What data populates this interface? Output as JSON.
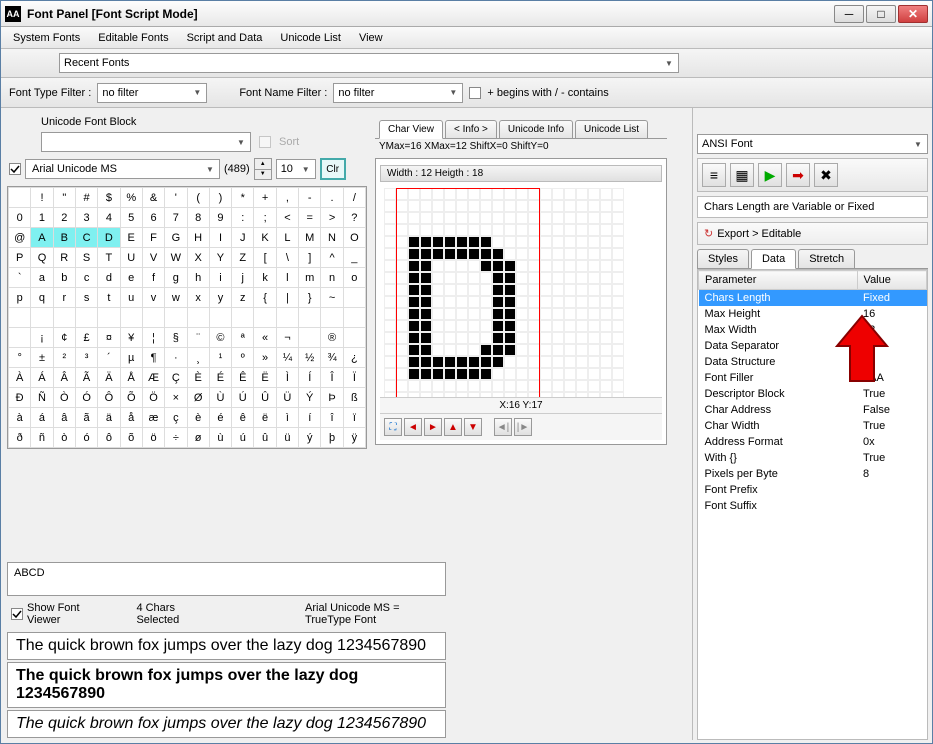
{
  "title": "Font Panel [Font Script Mode]",
  "menu": [
    "System Fonts",
    "Editable Fonts",
    "Script and Data",
    "Unicode List",
    "View"
  ],
  "recent_label": "Recent Fonts",
  "filter": {
    "type_label": "Font Type Filter :",
    "type_value": "no filter",
    "name_label": "Font Name Filter :",
    "name_value": "no filter",
    "begins_label": "+ begins with / - contains"
  },
  "block": {
    "label": "Unicode Font Block",
    "sort": "Sort"
  },
  "font": {
    "name": "Arial Unicode MS",
    "count": "(489)",
    "size": "10",
    "clr": "Clr"
  },
  "char_rows": [
    [
      "",
      "!",
      "\"",
      "#",
      "$",
      "%",
      "&",
      "'",
      "(",
      ")",
      "*",
      "+",
      ",",
      "-",
      ".",
      "/"
    ],
    [
      "0",
      "1",
      "2",
      "3",
      "4",
      "5",
      "6",
      "7",
      "8",
      "9",
      ":",
      ";",
      "<",
      "=",
      ">",
      "?"
    ],
    [
      "@",
      "A",
      "B",
      "C",
      "D",
      "E",
      "F",
      "G",
      "H",
      "I",
      "J",
      "K",
      "L",
      "M",
      "N",
      "O"
    ],
    [
      "P",
      "Q",
      "R",
      "S",
      "T",
      "U",
      "V",
      "W",
      "X",
      "Y",
      "Z",
      "[",
      "\\",
      "]",
      "^",
      "_"
    ],
    [
      "`",
      "a",
      "b",
      "c",
      "d",
      "e",
      "f",
      "g",
      "h",
      "i",
      "j",
      "k",
      "l",
      "m",
      "n",
      "o"
    ],
    [
      "p",
      "q",
      "r",
      "s",
      "t",
      "u",
      "v",
      "w",
      "x",
      "y",
      "z",
      "{",
      "|",
      "}",
      "~",
      ""
    ],
    [
      "",
      "",
      "",
      "",
      "",
      "",
      "",
      "",
      "",
      "",
      "",
      "",
      "",
      "",
      "",
      ""
    ],
    [
      "",
      "¡",
      "¢",
      "£",
      "¤",
      "¥",
      "¦",
      "§",
      "¨",
      "©",
      "ª",
      "«",
      "¬",
      "­",
      "®",
      ""
    ],
    [
      "°",
      "±",
      "²",
      "³",
      "´",
      "µ",
      "¶",
      "·",
      "¸",
      "¹",
      "º",
      "»",
      "¼",
      "½",
      "¾",
      "¿"
    ],
    [
      "À",
      "Á",
      "Â",
      "Ã",
      "Ä",
      "Å",
      "Æ",
      "Ç",
      "È",
      "É",
      "Ê",
      "Ë",
      "Ì",
      "Í",
      "Î",
      "Ï"
    ],
    [
      "Ð",
      "Ñ",
      "Ò",
      "Ó",
      "Ô",
      "Õ",
      "Ö",
      "×",
      "Ø",
      "Ù",
      "Ú",
      "Û",
      "Ü",
      "Ý",
      "Þ",
      "ß"
    ],
    [
      "à",
      "á",
      "â",
      "ã",
      "ä",
      "å",
      "æ",
      "ç",
      "è",
      "é",
      "ê",
      "ë",
      "ì",
      "í",
      "î",
      "ï"
    ],
    [
      "ð",
      "ñ",
      "ò",
      "ó",
      "ô",
      "õ",
      "ö",
      "÷",
      "ø",
      "ù",
      "ú",
      "û",
      "ü",
      "ý",
      "þ",
      "ÿ"
    ]
  ],
  "selected_chars": [
    "A",
    "B",
    "C",
    "D"
  ],
  "preview": {
    "tabs": [
      "Char View",
      "< Info >",
      "Unicode Info",
      "Unicode List"
    ],
    "info": "YMax=16  XMax=12  ShiftX=0  ShiftY=0",
    "width_height": "Width : 12  Heigth : 18",
    "coords": "X:16 Y:17"
  },
  "right": {
    "ansi": "ANSI Font",
    "status": "Chars Length are Variable or Fixed",
    "export": "Export > Editable",
    "tabs": [
      "Styles",
      "Data",
      "Stretch"
    ],
    "headers": [
      "Parameter",
      "Value"
    ],
    "rows": [
      [
        "Chars Length",
        "Fixed"
      ],
      [
        "Max Height",
        "16"
      ],
      [
        "Max Width",
        "12"
      ],
      [
        "Data Separator",
        ";"
      ],
      [
        "Data Structure",
        ""
      ],
      [
        "Font Filler",
        "0AA"
      ],
      [
        "Descriptor Block",
        "True"
      ],
      [
        "Char Address",
        "False"
      ],
      [
        "Char Width",
        "True"
      ],
      [
        "Address Format",
        "0x"
      ],
      [
        "With {}",
        "True"
      ],
      [
        "Pixels per Byte",
        "8"
      ],
      [
        "Font Prefix",
        ""
      ],
      [
        "Font Suffix",
        ""
      ]
    ]
  },
  "bottom": {
    "chars": "ABCD",
    "show_viewer": "Show Font Viewer",
    "selected": "4 Chars Selected",
    "font_info": "Arial Unicode MS = TrueType Font",
    "sample": "The quick brown fox jumps over the lazy dog 1234567890"
  }
}
